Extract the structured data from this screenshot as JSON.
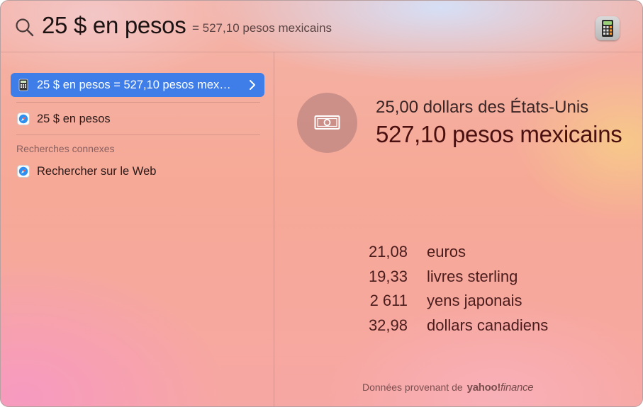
{
  "search": {
    "query": "25 $ en pesos",
    "inline_result": "= 527,10 pesos mexicains",
    "app_icon": "calculator-icon"
  },
  "results": {
    "top_hit": {
      "label": "25 $ en pesos = 527,10 pesos mex…",
      "icon": "calculator-icon",
      "selected": true
    },
    "web_suggestion": {
      "label": "25 $ en pesos",
      "icon": "safari-icon"
    },
    "related_header": "Recherches connexes",
    "related": [
      {
        "label": "Rechercher sur le Web",
        "icon": "safari-icon"
      }
    ]
  },
  "detail": {
    "icon": "banknote-icon",
    "from_amount": "25,00 dollars des États-Unis",
    "to_amount": "527,10 pesos mexicains",
    "conversions": [
      {
        "value": "21,08",
        "unit": "euros"
      },
      {
        "value": "19,33",
        "unit": "livres sterling"
      },
      {
        "value": "2 611",
        "unit": "yens japonais"
      },
      {
        "value": "32,98",
        "unit": "dollars canadiens"
      }
    ],
    "source_prefix": "Données provenant de",
    "source_brand": "yahoo!",
    "source_brand_suffix": "finance"
  },
  "colors": {
    "selection": "#3f7ee9",
    "accent_text": "#4a0f0f"
  }
}
